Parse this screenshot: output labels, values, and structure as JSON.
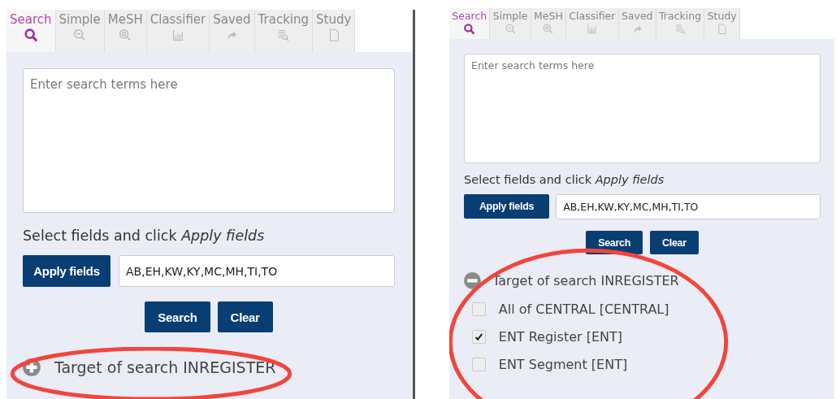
{
  "panels": [
    {
      "tabs": [
        {
          "label": "Search",
          "selected": true
        },
        {
          "label": "Simple",
          "selected": false
        },
        {
          "label": "MeSH",
          "selected": false
        },
        {
          "label": "Classifier",
          "selected": false
        },
        {
          "label": "Saved",
          "selected": false
        },
        {
          "label": "Tracking",
          "selected": false
        },
        {
          "label": "Study",
          "selected": false
        }
      ],
      "search_box": {
        "placeholder": "Enter search terms here"
      },
      "fields_label": "Select fields and click *Apply fields*",
      "apply_button": "Apply fields",
      "fields_value": "AB,EH,KW,KY,MC,MH,TI,TO",
      "buttons": [
        "Search",
        "Clear"
      ],
      "target": {
        "label": "Target of search INREGISTER",
        "expanded": false,
        "highlighted": true
      }
    },
    {
      "tabs": [
        {
          "label": "Search",
          "selected": true
        },
        {
          "label": "Simple",
          "selected": false
        },
        {
          "label": "MeSH",
          "selected": false
        },
        {
          "label": "Classifier",
          "selected": false
        },
        {
          "label": "Saved",
          "selected": false
        },
        {
          "label": "Tracking",
          "selected": false
        },
        {
          "label": "Study",
          "selected": false
        }
      ],
      "search_box": {
        "placeholder": "Enter search terms here"
      },
      "fields_label": "Select fields and click *Apply fields*",
      "apply_button": "Apply fields",
      "fields_value": "AB,EH,KW,KY,MC,MH,TI,TO",
      "buttons": [
        "Search",
        "Clear"
      ],
      "target": {
        "label": "Target of search INREGISTER",
        "expanded": true,
        "highlighted": true,
        "options": [
          {
            "label": "All of CENTRAL [CENTRAL]",
            "checked": false
          },
          {
            "label": "ENT Register [ENT]",
            "checked": true
          },
          {
            "label": "ENT Segment [ENT]",
            "checked": false
          }
        ]
      }
    }
  ]
}
